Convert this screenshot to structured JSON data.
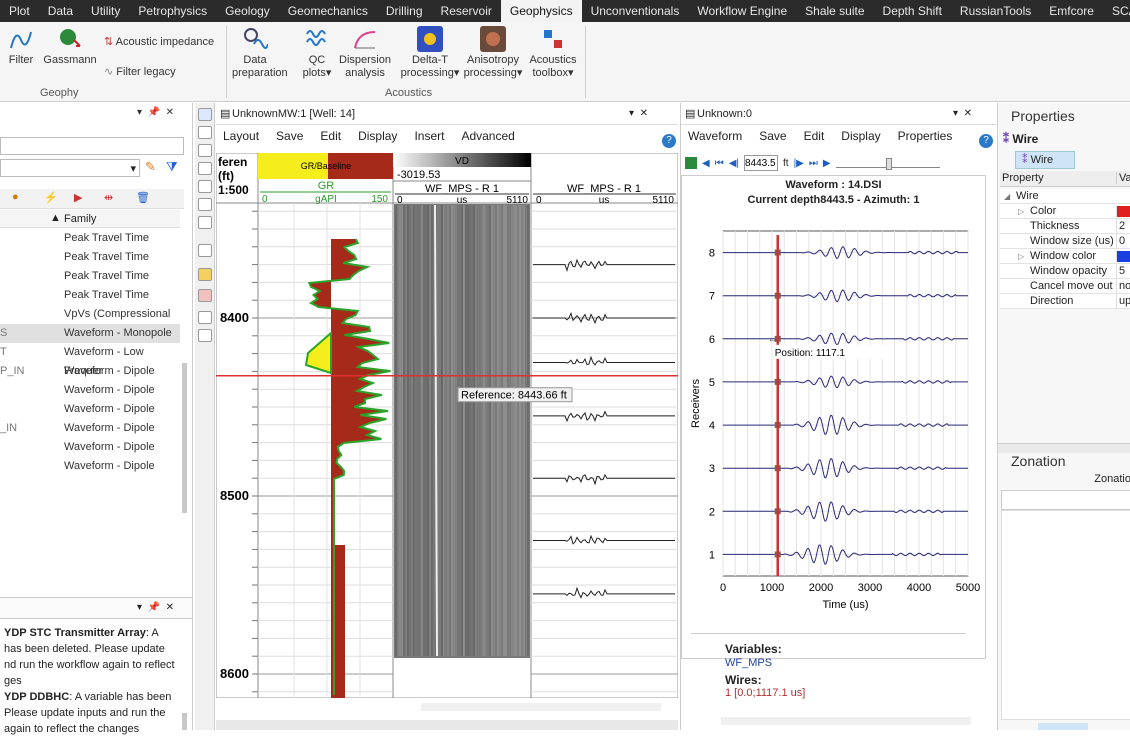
{
  "menubar": {
    "tabs": [
      "Plot",
      "Data",
      "Utility",
      "Petrophysics",
      "Geology",
      "Geomechanics",
      "Drilling",
      "Reservoir",
      "Geophysics",
      "Unconventionals",
      "Workflow Engine",
      "Shale suite",
      "Depth Shift",
      "RussianTools",
      "Emfcore",
      "SCAL"
    ],
    "active": "Geophysics"
  },
  "ribbon": {
    "filter": "Filter",
    "gassmann": "Gassmann",
    "acoustic_impedance": "Acoustic impedance",
    "filter_legacy": "Filter legacy",
    "group1": "Geophy",
    "data_prep": [
      "Data",
      "preparation"
    ],
    "qc_plots": [
      "QC",
      "plots"
    ],
    "dispersion": [
      "Dispersion",
      "analysis"
    ],
    "delta_t": [
      "Delta-T",
      "processing"
    ],
    "anisotropy": [
      "Anisotropy",
      "processing"
    ],
    "acoustics": [
      "Acoustics",
      "toolbox"
    ],
    "group2": "Acoustics"
  },
  "leftpanel": {
    "family_header": "Family",
    "rows": [
      {
        "pre": "",
        "fam": "Peak Travel Time"
      },
      {
        "pre": "",
        "fam": "Peak Travel Time"
      },
      {
        "pre": "",
        "fam": "Peak Travel Time"
      },
      {
        "pre": "",
        "fam": "Peak Travel Time"
      },
      {
        "pre": "",
        "fam": "VpVs (Compressional To"
      },
      {
        "pre": "S",
        "fam": "Waveform - Monopole"
      },
      {
        "pre": "T",
        "fam": "Waveform - Low Frequer"
      },
      {
        "pre": "P_IN",
        "fam": "Waveform - Dipole"
      },
      {
        "pre": "",
        "fam": "Waveform - Dipole"
      },
      {
        "pre": "",
        "fam": "Waveform - Dipole"
      },
      {
        "pre": "_IN",
        "fam": "Waveform - Dipole"
      },
      {
        "pre": "",
        "fam": "Waveform - Dipole"
      },
      {
        "pre": "",
        "fam": "Waveform - Dipole"
      }
    ],
    "messages": [
      {
        "bold": "YDP STC Transmitter Array",
        "text": ": A"
      },
      {
        "bold": "",
        "text": "has been deleted. Please update"
      },
      {
        "bold": "",
        "text": "nd run the workflow again to reflect"
      },
      {
        "bold": "",
        "text": "ges"
      },
      {
        "bold": "YDP DDBHC",
        "text": ": A variable has been"
      },
      {
        "bold": "",
        "text": "Please update inputs and run the"
      },
      {
        "bold": "",
        "text": "again to reflect the changes"
      }
    ]
  },
  "wellpanel": {
    "title": "UnknownMW:1 [Well: 14]",
    "menu": [
      "Layout",
      "Save",
      "Edit",
      "Display",
      "Insert",
      "Advanced"
    ],
    "depth_header": [
      "feren",
      "(ft)",
      "1:500"
    ],
    "gr_title": "GR/Baseline",
    "gr_curve": "GR",
    "gr_unit": "gAPI",
    "gr_min": "0",
    "gr_max": "150",
    "vd_title": "VD",
    "vd_value": "-3019.53",
    "wf1_title": "WF_MPS - R 1",
    "wf2_title": "WF_MPS - R 1",
    "wf_unit": "us",
    "wf_min": "0",
    "wf_max": "5110",
    "depths": [
      "8400",
      "8500",
      "8600"
    ],
    "reference": "Reference: 8443.66 ft"
  },
  "wavepanel": {
    "title": "Unknown:0",
    "menu": [
      "Waveform",
      "Save",
      "Edit",
      "Display",
      "Properties"
    ],
    "depth_input": "8443.5",
    "depth_unit": "ft",
    "chart_title": "Waveform : 14.DSI",
    "chart_subtitle": "Current depth8443.5 - Azimuth: 1",
    "position": "Position: 1117.1",
    "ylabel": "Receivers",
    "xlabel": "Time (us)",
    "variables_label": "Variables:",
    "variables_value": "WF_MPS",
    "wires_label": "Wires:",
    "wires_value": "1 [0.0;1117.1 us]"
  },
  "chart_data": {
    "type": "line",
    "title": "Waveform : 14.DSI",
    "subtitle": "Current depth8443.5 - Azimuth: 1",
    "xlabel": "Time (us)",
    "ylabel": "Receivers",
    "xlim": [
      0,
      5000
    ],
    "ylim": [
      0.5,
      8.5
    ],
    "xticks": [
      0,
      1000,
      2000,
      3000,
      4000,
      5000
    ],
    "yticks": [
      1,
      2,
      3,
      4,
      5,
      6,
      7,
      8
    ],
    "marker_x": 1117.1,
    "series": [
      {
        "receiver": 1,
        "arrival_us": 1950
      },
      {
        "receiver": 2,
        "arrival_us": 2000
      },
      {
        "receiver": 3,
        "arrival_us": 2050
      },
      {
        "receiver": 4,
        "arrival_us": 2100
      },
      {
        "receiver": 5,
        "arrival_us": 2150
      },
      {
        "receiver": 6,
        "arrival_us": 2200
      },
      {
        "receiver": 7,
        "arrival_us": 2250
      },
      {
        "receiver": 8,
        "arrival_us": 2300
      }
    ]
  },
  "proppanel": {
    "title": "Properties",
    "wire_title": "Wire",
    "wire_tab": "Wire",
    "col_property": "Property",
    "col_value": "Valu",
    "rows": [
      {
        "k": "Wire",
        "v": "",
        "sub": false
      },
      {
        "k": "Color",
        "v": "",
        "color": "#e02020",
        "sub": true
      },
      {
        "k": "Thickness",
        "v": "2",
        "sub": true
      },
      {
        "k": "Window size (us)",
        "v": "0",
        "sub": true
      },
      {
        "k": "Window color",
        "v": "",
        "color": "#1a3fe0",
        "sub": true
      },
      {
        "k": "Window opacity",
        "v": "5",
        "sub": true
      },
      {
        "k": "Cancel move out",
        "v": "no",
        "sub": true
      },
      {
        "k": "Direction",
        "v": "up",
        "sub": true
      }
    ],
    "zonation_title": "Zonation",
    "zonation_col": "Zonatio"
  },
  "colors": {
    "gr_fill": "#a52a1a",
    "gr_line": "#2aa52a",
    "yellow": "#f5ee1c",
    "ref_line": "#e03030",
    "wave": "#2a2a7a",
    "marker": "#d03030"
  }
}
